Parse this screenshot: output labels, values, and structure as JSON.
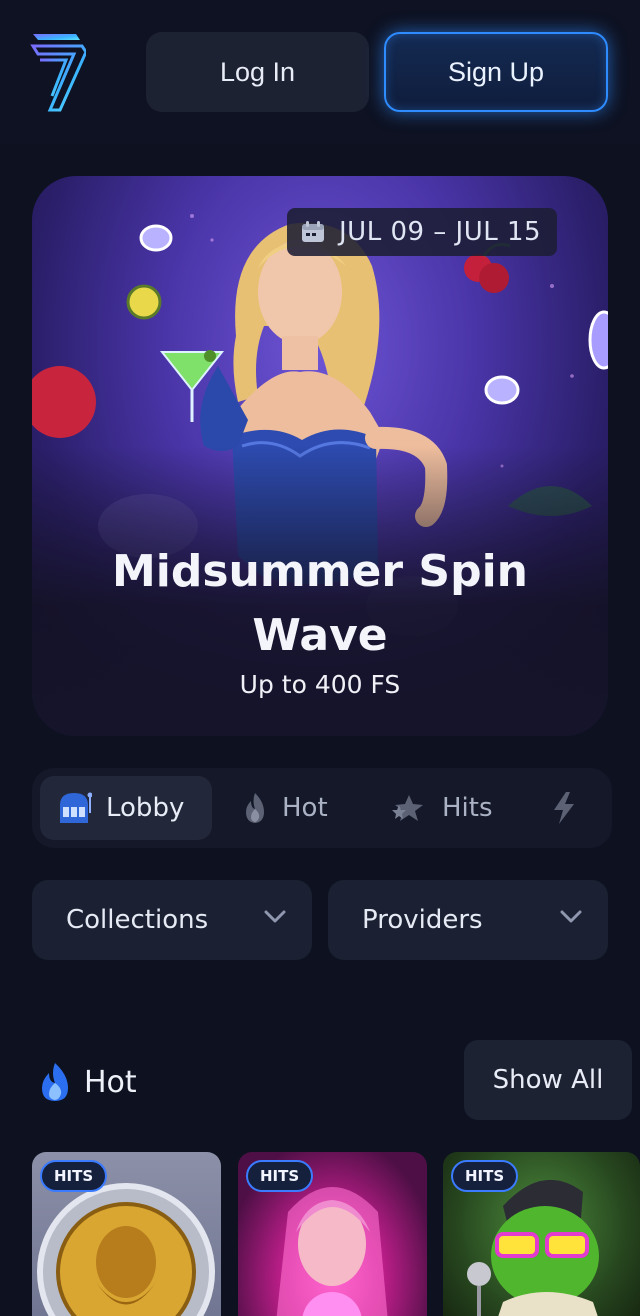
{
  "header": {
    "login_label": "Log In",
    "signup_label": "Sign Up",
    "logo": "seven-logo-icon"
  },
  "hero": {
    "date_range": "JUL 09 – JUL 15",
    "title_line1": "Midsummer Spin",
    "title_line2": "Wave",
    "subtitle": "Up to 400 FS"
  },
  "tabs": [
    {
      "label": "Lobby",
      "icon": "slot-machine-icon",
      "active": true
    },
    {
      "label": "Hot",
      "icon": "flame-icon",
      "active": false
    },
    {
      "label": "Hits",
      "icon": "stars-icon",
      "active": false
    },
    {
      "label": "",
      "icon": "lightning-icon",
      "active": false
    }
  ],
  "filters": {
    "collections_label": "Collections",
    "providers_label": "Providers"
  },
  "hot_section": {
    "title": "Hot",
    "show_all_label": "Show All",
    "games": [
      {
        "badge": "HITS"
      },
      {
        "badge": "HITS"
      },
      {
        "badge": "HITS"
      }
    ]
  },
  "colors": {
    "background": "#0d1120",
    "accent": "#2e8cff",
    "surface": "#1b2032"
  }
}
